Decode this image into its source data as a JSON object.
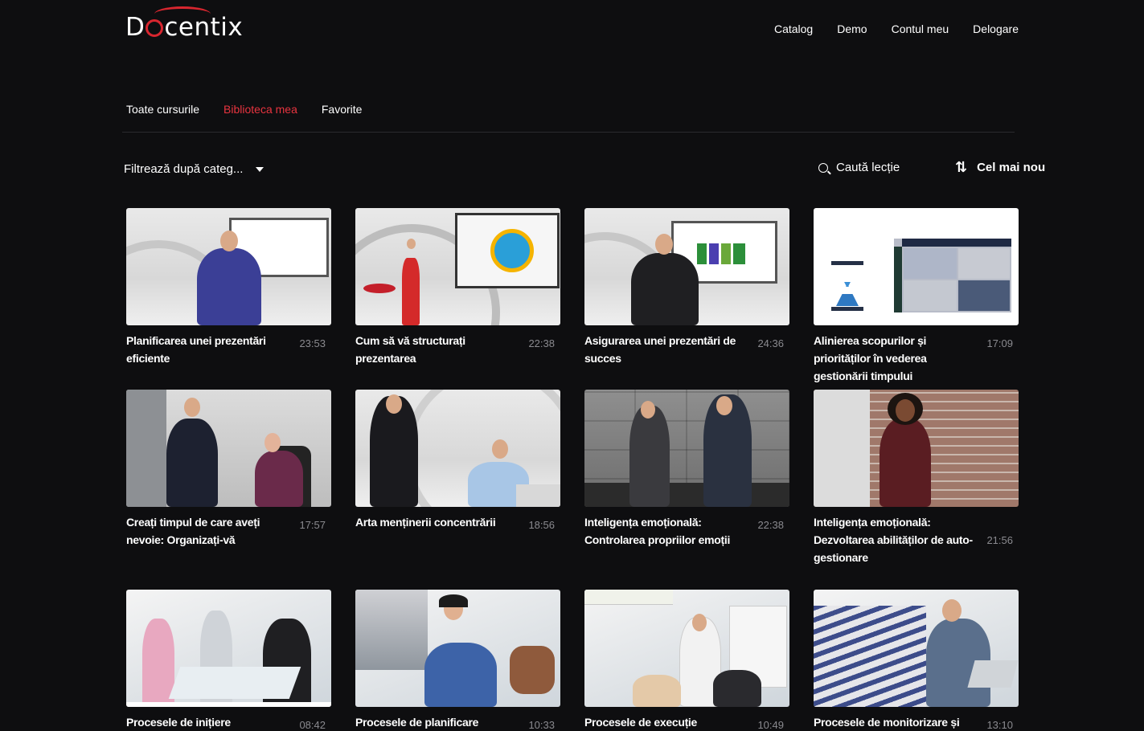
{
  "brand": {
    "logo_text": "Docentix",
    "accent": "#e8343f"
  },
  "topnav": [
    "Catalog",
    "Demo",
    "Contul meu",
    "Delogare"
  ],
  "tabs": [
    {
      "label": "Toate cursurile",
      "active": false
    },
    {
      "label": "Biblioteca mea",
      "active": true
    },
    {
      "label": "Favorite",
      "active": false
    }
  ],
  "filter": {
    "label": "Filtrează după categ...",
    "icon": "chevron-down-icon"
  },
  "search": {
    "placeholder": "Caută lecție",
    "icon": "search-icon"
  },
  "sort": {
    "label": "Cel mai nou",
    "icon": "sort-arrows-icon"
  },
  "courses": [
    {
      "title": "Planificarea unei prezentări eficiente",
      "duration": "23:53"
    },
    {
      "title": "Cum să vă structurați prezentarea",
      "duration": "22:38"
    },
    {
      "title": "Asigurarea unei prezentări de succes",
      "duration": "24:36"
    },
    {
      "title": "Alinierea scopurilor și priorităților în vederea gestionării timpului",
      "duration": "17:09"
    },
    {
      "title": "Creați timpul de care aveți nevoie: Organizați-vă",
      "duration": "17:57"
    },
    {
      "title": "Arta menținerii concentrării",
      "duration": "18:56"
    },
    {
      "title": "Inteligența emoțională: Controlarea propriilor emoții",
      "duration": "22:38"
    },
    {
      "title": "Inteligența emoțională: Dezvoltarea abilităților de auto-gestionare",
      "duration": "21:56"
    },
    {
      "title": "Procesele de inițiere",
      "duration": "08:42"
    },
    {
      "title": "Procesele de planificare",
      "duration": "10:33"
    },
    {
      "title": "Procesele de execuție",
      "duration": "10:49"
    },
    {
      "title": "Procesele de monitorizare și",
      "duration": "13:10"
    }
  ]
}
